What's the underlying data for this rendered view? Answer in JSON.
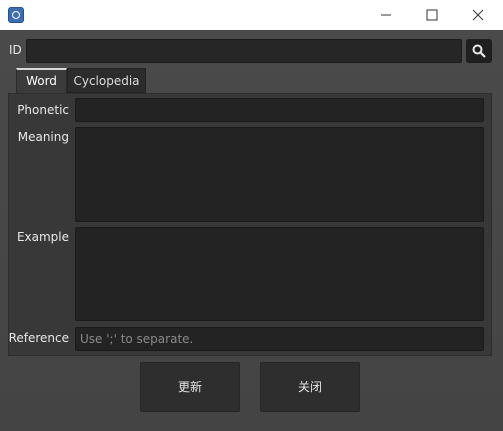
{
  "window": {
    "controls": {
      "minimize": "minimize-icon",
      "maximize": "maximize-icon",
      "close": "close-icon"
    }
  },
  "search": {
    "id_label": "ID",
    "id_value": "",
    "button_icon": "search-icon"
  },
  "tabs": [
    {
      "label": "Word",
      "active": true
    },
    {
      "label": "Cyclopedia",
      "active": false
    }
  ],
  "word_form": {
    "phonetic_label": "Phonetic",
    "phonetic_value": "",
    "meaning_label": "Meaning",
    "meaning_value": "",
    "example_label": "Example",
    "example_value": "",
    "reference_label": "Reference",
    "reference_placeholder": "Use ';' to separate.",
    "reference_value": ""
  },
  "actions": {
    "update_label": "更新",
    "close_label": "关闭"
  },
  "colors": {
    "background": "#454545",
    "field": "#232323",
    "button": "#2e2e2e"
  }
}
